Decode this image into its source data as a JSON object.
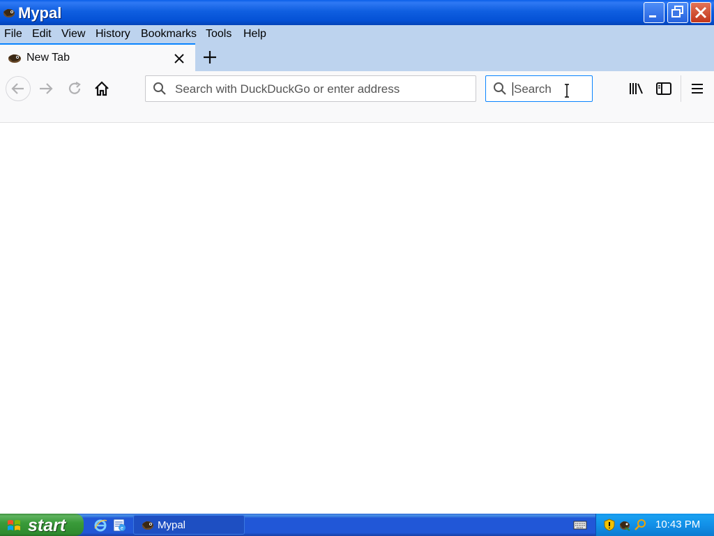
{
  "window": {
    "title": "Mypal"
  },
  "menu": {
    "items": [
      "File",
      "Edit",
      "View",
      "History",
      "Bookmarks",
      "Tools",
      "Help"
    ]
  },
  "tab": {
    "title": "New Tab"
  },
  "urlbar": {
    "placeholder": "Search with DuckDuckGo or enter address",
    "value": ""
  },
  "searchbar": {
    "placeholder": "Search",
    "value": ""
  },
  "taskbar": {
    "start_label": "start",
    "task_label": "Mypal",
    "clock": "10:43 PM"
  },
  "colors": {
    "accent": "#0a84ff",
    "titlebar": "#0552d6",
    "menubar": "#bdd3ee",
    "taskbar": "#2157d7",
    "start": "#3a9b3a",
    "tray": "#1290e8"
  },
  "icons": [
    "app-icon",
    "minimize-icon",
    "maximize-icon",
    "close-icon",
    "tab-close-icon",
    "plus-icon",
    "back-icon",
    "forward-icon",
    "reload-icon",
    "home-icon",
    "search-icon",
    "library-icon",
    "sidebar-icon",
    "menu-icon",
    "windows-logo-icon",
    "ie-icon",
    "outlook-icon",
    "keyboard-icon",
    "security-shield-icon",
    "mypal-tray-icon",
    "search-tray-icon"
  ]
}
